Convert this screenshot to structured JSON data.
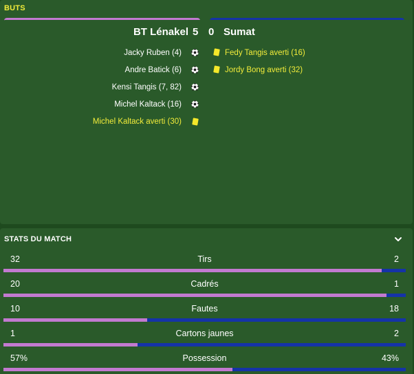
{
  "colors": {
    "home": "#c27ad0",
    "away": "#1533a8",
    "highlight": "#f2ec3a"
  },
  "goals": {
    "title": "BUTS",
    "home_team": "BT Lénakel",
    "home_score": "5",
    "away_score": "0",
    "away_team": "Sumat",
    "home_events": [
      {
        "text": "Jacky Ruben (4)",
        "icon": "ball-icon"
      },
      {
        "text": "Andre Batick (6)",
        "icon": "ball-icon"
      },
      {
        "text": "Kensi Tangis (7, 82)",
        "icon": "ball-icon"
      },
      {
        "text": "Michel Kaltack (16)",
        "icon": "ball-icon"
      },
      {
        "text": "Michel Kaltack averti (30)",
        "icon": "yellow-card-icon"
      }
    ],
    "away_events": [
      {
        "text": "Fedy Tangis averti (16)",
        "icon": "yellow-card-icon"
      },
      {
        "text": "Jordy Bong averti (32)",
        "icon": "yellow-card-icon"
      }
    ]
  },
  "stats": {
    "title": "STATS DU MATCH",
    "toggle_icon": "chevron-down-icon",
    "rows": [
      {
        "label": "Tirs",
        "home": "32",
        "away": "2",
        "home_share": 0.941
      },
      {
        "label": "Cadrés",
        "home": "20",
        "away": "1",
        "home_share": 0.952
      },
      {
        "label": "Fautes",
        "home": "10",
        "away": "18",
        "home_share": 0.357
      },
      {
        "label": "Cartons jaunes",
        "home": "1",
        "away": "2",
        "home_share": 0.333
      },
      {
        "label": "Possession",
        "home": "57%",
        "away": "43%",
        "home_share": 0.57
      }
    ]
  }
}
